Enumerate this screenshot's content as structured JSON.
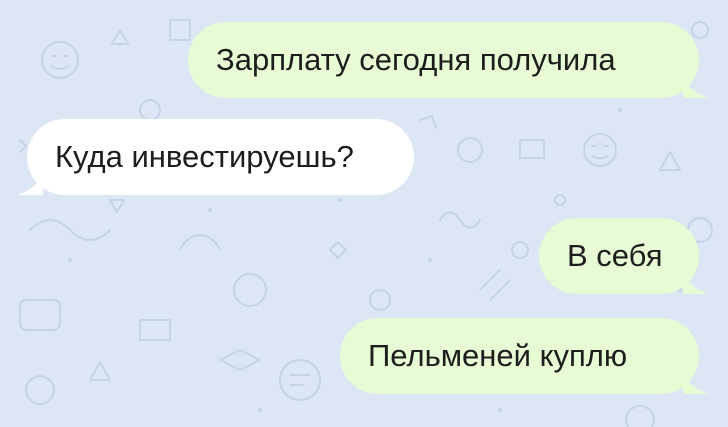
{
  "chat": {
    "messages": [
      {
        "direction": "outgoing",
        "text": "Зарплату сегодня получила"
      },
      {
        "direction": "incoming",
        "text": "Куда инвестируешь?"
      },
      {
        "direction": "outgoing",
        "text": "В себя"
      },
      {
        "direction": "outgoing",
        "text": "Пельменей куплю"
      }
    ]
  },
  "colors": {
    "background": "#dce6f4",
    "outgoing_bubble": "#e7fbd4",
    "incoming_bubble": "#ffffff",
    "text": "#1d1d1d"
  }
}
